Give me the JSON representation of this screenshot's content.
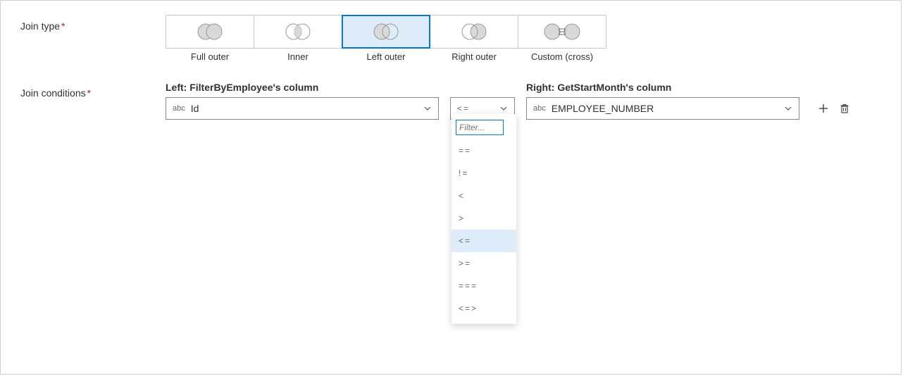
{
  "join_type": {
    "label": "Join type",
    "options": [
      {
        "key": "full",
        "label": "Full outer",
        "variant": "full"
      },
      {
        "key": "inner",
        "label": "Inner",
        "variant": "inner"
      },
      {
        "key": "left",
        "label": "Left outer",
        "variant": "left"
      },
      {
        "key": "right",
        "label": "Right outer",
        "variant": "right"
      },
      {
        "key": "cross",
        "label": "Custom (cross)",
        "variant": "cross"
      }
    ],
    "selected": "left"
  },
  "join_conditions": {
    "label": "Join conditions",
    "left_header": "Left: FilterByEmployee's column",
    "right_header": "Right: GetStartMonth's column",
    "row": {
      "left_type": "abc",
      "left_value": "Id",
      "operator": "<=",
      "right_type": "abc",
      "right_value": "EMPLOYEE_NUMBER"
    }
  },
  "operator_dropdown": {
    "filter_placeholder": "Filter...",
    "options": [
      "==",
      "!=",
      "<",
      ">",
      "<=",
      ">=",
      "===",
      "<=>"
    ],
    "selected": "<="
  }
}
